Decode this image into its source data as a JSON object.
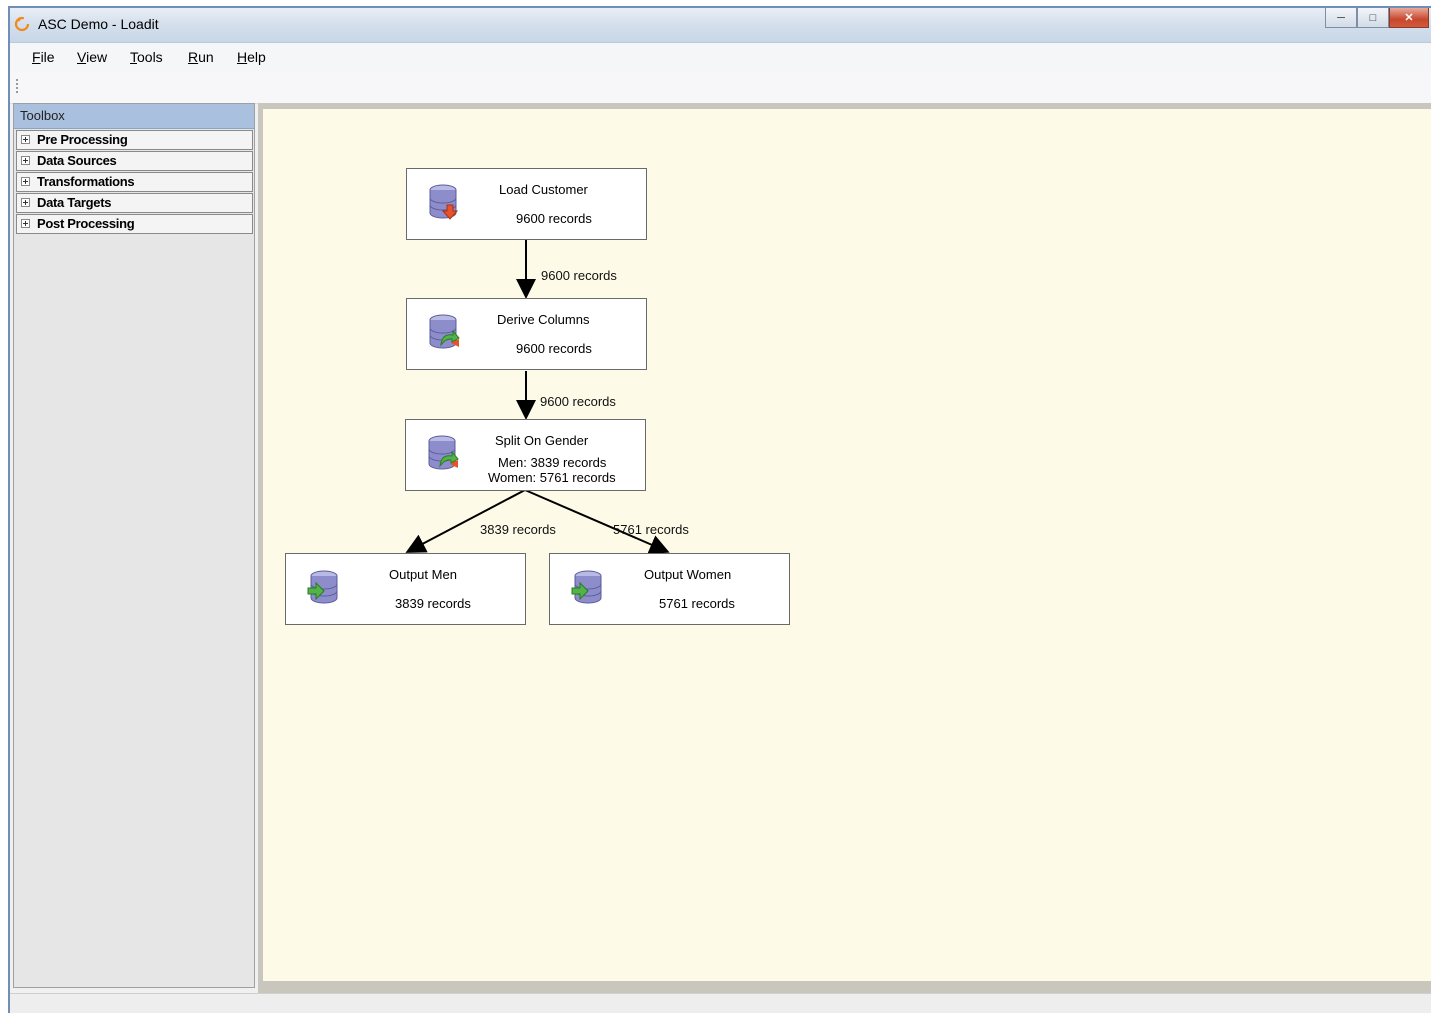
{
  "window": {
    "title": "ASC Demo - Loadit"
  },
  "menu": [
    {
      "label": "File"
    },
    {
      "label": "View"
    },
    {
      "label": "Tools"
    },
    {
      "label": "Run"
    },
    {
      "label": "Help"
    }
  ],
  "toolbox": {
    "header": "Toolbox",
    "items": [
      {
        "label": "Pre Processing"
      },
      {
        "label": "Data Sources"
      },
      {
        "label": "Transformations"
      },
      {
        "label": "Data Targets"
      },
      {
        "label": "Post Processing"
      }
    ]
  },
  "nodes": {
    "load_customer": {
      "name": "Load Customer",
      "records": "9600 records",
      "icon": "database-import-icon"
    },
    "derive_columns": {
      "name": "Derive Columns",
      "records": "9600 records",
      "icon": "database-transform-icon"
    },
    "split_on_gender": {
      "name": "Split On Gender",
      "men": "Men: 3839 records",
      "women": "Women: 5761 records",
      "icon": "database-transform-icon"
    },
    "output_men": {
      "name": "Output Men",
      "records": "3839 records",
      "icon": "database-export-icon"
    },
    "output_women": {
      "name": "Output Women",
      "records": "5761 records",
      "icon": "database-export-icon"
    }
  },
  "edges": {
    "load_to_derive": "9600 records",
    "derive_to_split": "9600 records",
    "split_to_men": "3839 records",
    "split_to_women": "5761 records"
  },
  "colors": {
    "canvas_bg": "#fdfbe8",
    "toolbox_header": "#a9c1de",
    "canvas_frame": "#c9c7bd"
  }
}
